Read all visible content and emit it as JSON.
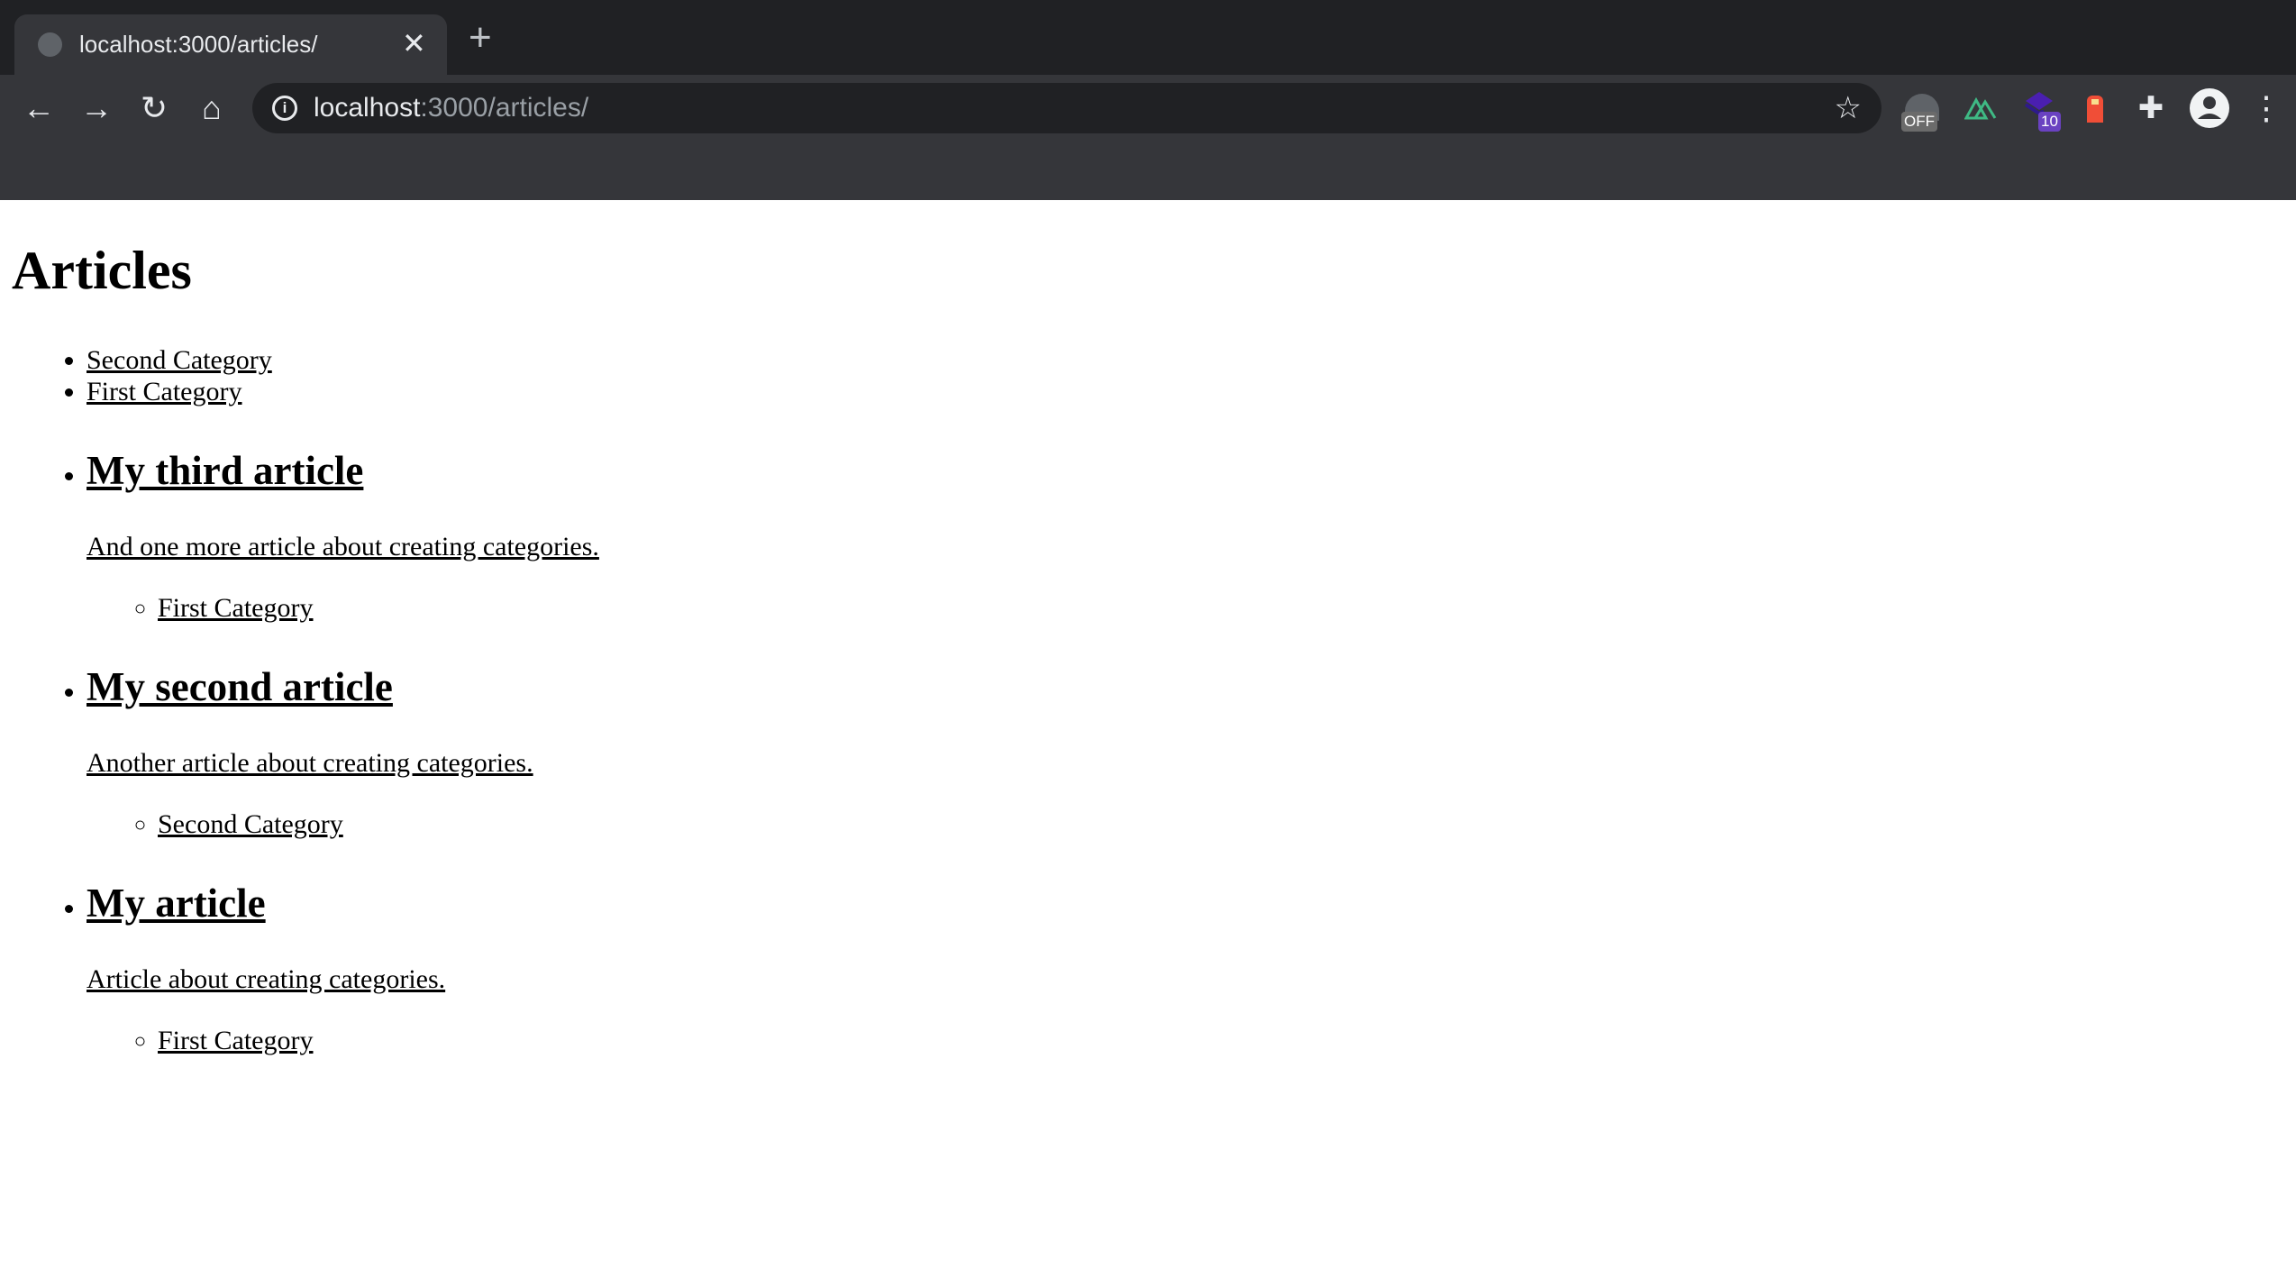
{
  "browser": {
    "tab_title": "localhost:3000/articles/",
    "url_host": "localhost",
    "url_rest": ":3000/articles/",
    "extensions": [
      {
        "icon": "extension-off-icon",
        "badge": "OFF"
      },
      {
        "icon": "vue-devtools-icon"
      },
      {
        "icon": "stack-extension-icon",
        "badge": "10"
      },
      {
        "icon": "lighthouse-icon"
      },
      {
        "icon": "puzzle-icon"
      },
      {
        "icon": "profile-icon"
      },
      {
        "icon": "more-menu-icon"
      }
    ]
  },
  "page": {
    "title": "Articles",
    "categories": [
      "Second Category",
      "First Category"
    ],
    "articles": [
      {
        "title": "My third article",
        "summary": "And one more article about creating categories.",
        "categories": [
          "First Category"
        ]
      },
      {
        "title": "My second article",
        "summary": "Another article about creating categories.",
        "categories": [
          "Second Category"
        ]
      },
      {
        "title": "My article",
        "summary": "Article about creating categories.",
        "categories": [
          "First Category"
        ]
      }
    ]
  }
}
